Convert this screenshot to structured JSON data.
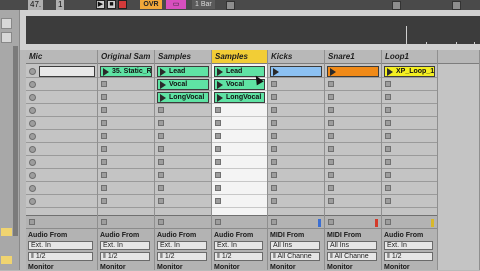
{
  "topbar": {
    "measure": "47.",
    "step": "1",
    "ovr_label": "OVR",
    "bar_label": "1 Bar"
  },
  "tracks": [
    {
      "name": "Mic",
      "selected": false,
      "clips": [],
      "footer": {
        "section": "Audio From",
        "source": "Ext. In",
        "channel": "1/2",
        "monitor": "Monitor"
      }
    },
    {
      "name": "Original Sam",
      "selected": false,
      "clips": [
        {
          "label": "35. Static_R",
          "color": "#5fe3a4"
        }
      ],
      "footer": {
        "section": "Audio From",
        "source": "Ext. In",
        "channel": "1/2",
        "monitor": "Monitor"
      }
    },
    {
      "name": "Samples",
      "selected": false,
      "clips": [
        {
          "label": "Lead",
          "color": "#5fe3a4"
        },
        {
          "label": "Vocal",
          "color": "#5fe3a4"
        },
        {
          "label": "LongVocal",
          "color": "#5fe3a4"
        }
      ],
      "footer": {
        "section": "Audio From",
        "source": "Ext. In",
        "channel": "1/2",
        "monitor": "Monitor"
      }
    },
    {
      "name": "Samples",
      "selected": true,
      "clips": [
        {
          "label": "Lead",
          "color": "#5fe3a4"
        },
        {
          "label": "Vocal",
          "color": "#5fe3a4"
        },
        {
          "label": "LongVocal",
          "color": "#5fe3a4"
        }
      ],
      "footer": {
        "section": "Audio From",
        "source": "Ext. In",
        "channel": "1/2",
        "monitor": "Monitor"
      }
    },
    {
      "name": "Kicks",
      "selected": false,
      "clips": [
        {
          "label": "",
          "color": "#8cc1f2"
        }
      ],
      "footer": {
        "section": "MIDI From",
        "source": "All Ins",
        "channel": "All Channe",
        "monitor": "Monitor"
      }
    },
    {
      "name": "Snare1",
      "selected": false,
      "clips": [
        {
          "label": "",
          "color": "#f08a18"
        }
      ],
      "footer": {
        "section": "MIDI From",
        "source": "All Ins",
        "channel": "All Channe",
        "monitor": "Monitor"
      }
    },
    {
      "name": "Loop1",
      "selected": false,
      "clips": [
        {
          "label": "XP_Loop_1(",
          "color": "#f4ef22"
        }
      ],
      "footer": {
        "section": "Audio From",
        "source": "Ext. In",
        "channel": "1/2",
        "monitor": "Monitor"
      }
    }
  ]
}
